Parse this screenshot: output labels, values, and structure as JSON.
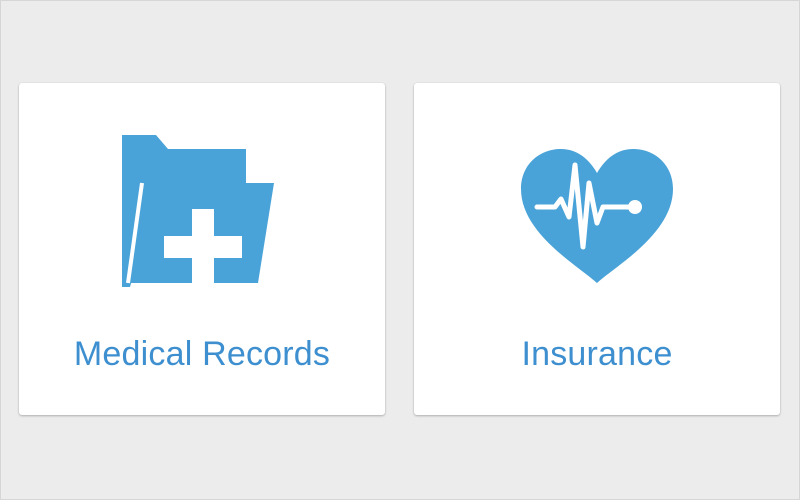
{
  "colors": {
    "background": "#ececec",
    "card": "#ffffff",
    "accent": "#4aa3d8",
    "label": "#3d8fcf"
  },
  "tiles": [
    {
      "label": "Medical Records",
      "icon": "medical-folder-icon"
    },
    {
      "label": "Insurance",
      "icon": "heartbeat-icon"
    }
  ]
}
